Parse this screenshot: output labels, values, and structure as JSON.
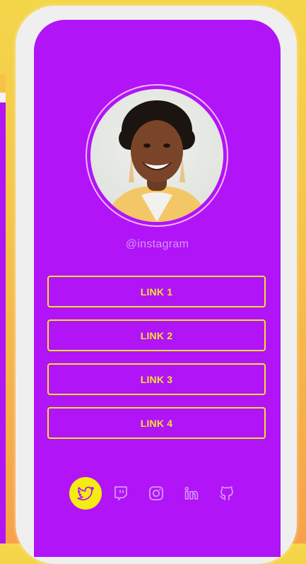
{
  "profile": {
    "handle": "@instagram",
    "avatar_alt": "profile photo of smiling woman"
  },
  "links": [
    {
      "label": "LINK 1"
    },
    {
      "label": "LINK 2"
    },
    {
      "label": "LINK 3"
    },
    {
      "label": "LINK 4"
    }
  ],
  "social": [
    {
      "icon": "twitter-icon",
      "active": true
    },
    {
      "icon": "twitch-icon",
      "active": false
    },
    {
      "icon": "instagram-icon",
      "active": false
    },
    {
      "icon": "linkedin-icon",
      "active": false
    },
    {
      "icon": "github-icon",
      "active": false
    }
  ],
  "colors": {
    "screen_bg": "#b114f6",
    "accent_yellow": "#f4e12d",
    "handle_text": "#d795fb",
    "frame": "#efeff0",
    "social_active_bg": "#f4ec12"
  }
}
